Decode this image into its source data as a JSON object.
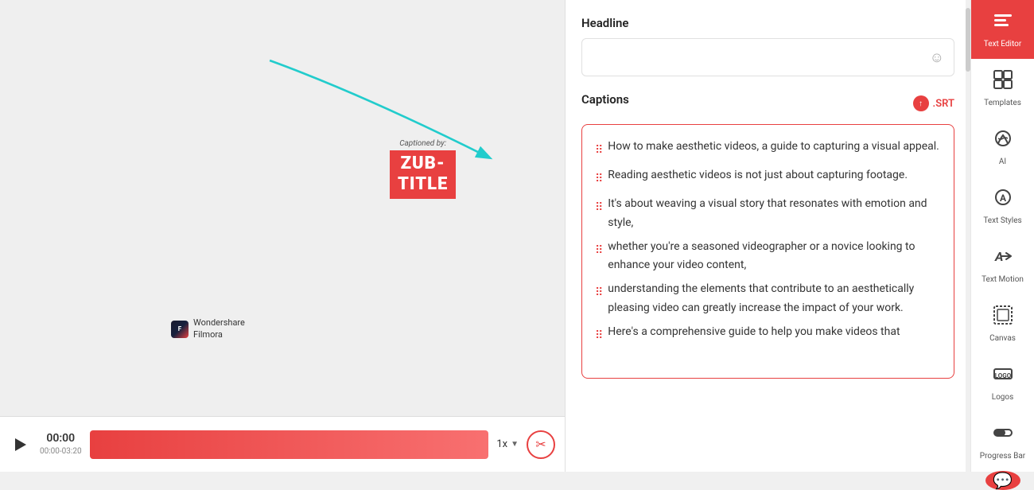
{
  "preview": {
    "watermark_brand": "Wondershare\nFilmora",
    "subtitle_captioned_by": "Captioned by:",
    "subtitle_line1": "ZUB-",
    "subtitle_line2": "TITLE"
  },
  "playback": {
    "play_label": "▶",
    "time_current": "00:00",
    "time_range": "00:00-03:20",
    "speed": "1x",
    "scissors_label": "✂"
  },
  "panel": {
    "headline_label": "Headline",
    "headline_placeholder": "",
    "emoji_icon": "☺",
    "captions_label": "Captions",
    "srt_label": ".SRT",
    "caption_lines": [
      "How to make aesthetic videos, a guide to capturing a visual appeal.",
      "Reading aesthetic videos is not just about capturing footage.",
      "It's about weaving a visual story that resonates with emotion and style,",
      "whether you're a seasoned videographer or a novice looking to enhance your video content,",
      "understanding the elements that contribute to an aesthetically pleasing video can greatly increase the impact of your work.",
      "Here's a comprehensive guide to help you make videos that"
    ]
  },
  "sidebar": {
    "items": [
      {
        "id": "text-editor",
        "label": "Text Editor",
        "active": true
      },
      {
        "id": "templates",
        "label": "Templates",
        "active": false
      },
      {
        "id": "ai",
        "label": "AI",
        "active": false
      },
      {
        "id": "text-styles",
        "label": "Text Styles",
        "active": false
      },
      {
        "id": "text-motion",
        "label": "Text Motion",
        "active": false
      },
      {
        "id": "canvas",
        "label": "Canvas",
        "active": false
      },
      {
        "id": "logos",
        "label": "Logos",
        "active": false
      },
      {
        "id": "progress-bar",
        "label": "Progress Bar",
        "active": false
      }
    ],
    "chat_icon": "💬"
  }
}
